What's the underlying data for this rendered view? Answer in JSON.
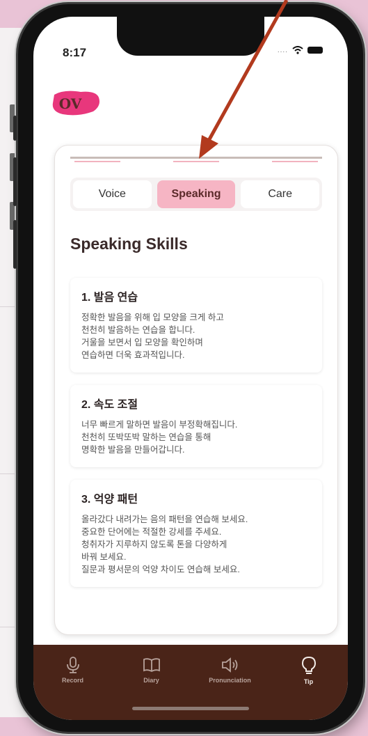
{
  "status_bar": {
    "time": "8:17",
    "dots": "...."
  },
  "logo": {
    "text": "OV",
    "color": "#e8377c"
  },
  "tabs": [
    {
      "label": "Voice",
      "active": false
    },
    {
      "label": "Speaking",
      "active": true
    },
    {
      "label": "Care",
      "active": false
    }
  ],
  "section": {
    "title": "Speaking Skills"
  },
  "items": [
    {
      "title": "1. 발음 연습",
      "body": "정확한 발음을 위해 입 모양을 크게 하고\n천천히 발음하는 연습을 합니다.\n거울을 보면서 입 모양을 확인하며\n연습하면 더욱 효과적입니다."
    },
    {
      "title": "2. 속도 조절",
      "body": "너무 빠르게 말하면 발음이 부정확해집니다.\n천천히 또박또박 말하는 연습을 통해\n명확한 발음을 만들어갑니다."
    },
    {
      "title": "3. 억양 패턴",
      "body": "올라갔다 내려가는 음의 패턴을 연습해 보세요.\n중요한 단어에는 적절한 강세를 주세요.\n청취자가 지루하지 않도록 톤을 다양하게\n바꿔 보세요.\n질문과 평서문의 억양 차이도 연습해 보세요."
    }
  ],
  "tabbar": [
    {
      "label": "Record",
      "icon": "mic-icon",
      "active": false
    },
    {
      "label": "Diary",
      "icon": "book-icon",
      "active": false
    },
    {
      "label": "Pronunciation",
      "icon": "speaker-icon",
      "active": false
    },
    {
      "label": "Tip",
      "icon": "lightbulb-icon",
      "active": true
    }
  ],
  "colors": {
    "accent": "#f6b5c4",
    "tabbar": "#4a2418",
    "arrow": "#b23a1e"
  }
}
